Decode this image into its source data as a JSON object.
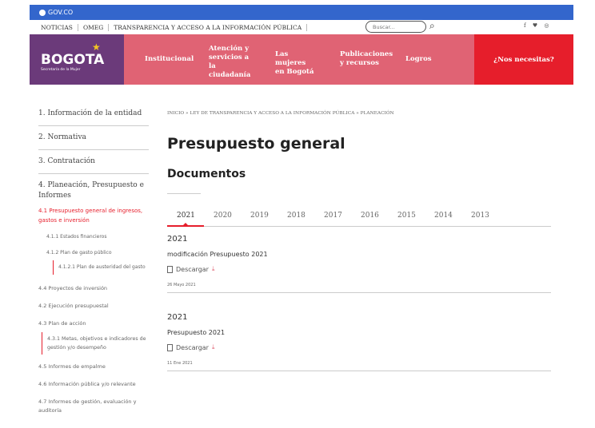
{
  "gov": {
    "label": "GOV.CO"
  },
  "topbar": {
    "links": [
      "NOTICIAS",
      "OMEG",
      "TRANSPARENCIA Y ACCESO A LA INFORMACIÓN PÚBLICA"
    ],
    "search_placeholder": "Buscar...",
    "social": "f ♥ ◎"
  },
  "brand": {
    "name": "BOGOTA",
    "sub": "Secretaría de la Mujer"
  },
  "nav": {
    "items": [
      "Institucional",
      "Atención y servicios a la ciudadanía",
      "Las mujeres en Bogotá",
      "Publicaciones y recursos",
      "Logros"
    ],
    "cta": "¿Nos necesitas?"
  },
  "sidebar": {
    "items": [
      "1. Información de la entidad",
      "2. Normativa",
      "3. Contratación",
      "4. Planeación, Presupuesto e Informes"
    ],
    "active": "4.1 Presupuesto general de ingresos, gastos e inversión",
    "sub_items": [
      "4.1.1 Estados financieros",
      "4.1.2 Plan de gasto público"
    ],
    "sub_sub_item": "4.1.2.1 Plan de austeridad del gasto",
    "items2": [
      "4.4 Proyectos de inversión",
      "4.2 Ejecución presupuestal",
      "4.3 Plan de acción"
    ],
    "sub_item2": "4.3.1 Metas, objetivos e indicadores de gestión y/o desempeño",
    "items3": [
      "4.5 Informes de empalme",
      "4.6 Información pública y/o relevante",
      "4.7 Informes de gestión, evaluación y auditoría"
    ]
  },
  "breadcrumb": "INICIO » LEY DE TRANSPARENCIA Y ACCESO A LA INFORMACIÓN PÚBLICA » PLANEACIÓN",
  "page": {
    "title": "Presupuesto general",
    "subtitle": "Documentos"
  },
  "years": [
    "2021",
    "2020",
    "2019",
    "2018",
    "2017",
    "2016",
    "2015",
    "2014",
    "2013"
  ],
  "documents": [
    {
      "year": "2021",
      "name": "modificación Presupuesto 2021",
      "download": "Descargar",
      "date": "26 Mayo 2021"
    },
    {
      "year": "2021",
      "name": "Presupuesto 2021",
      "download": "Descargar",
      "date": "11 Ene 2021"
    }
  ]
}
